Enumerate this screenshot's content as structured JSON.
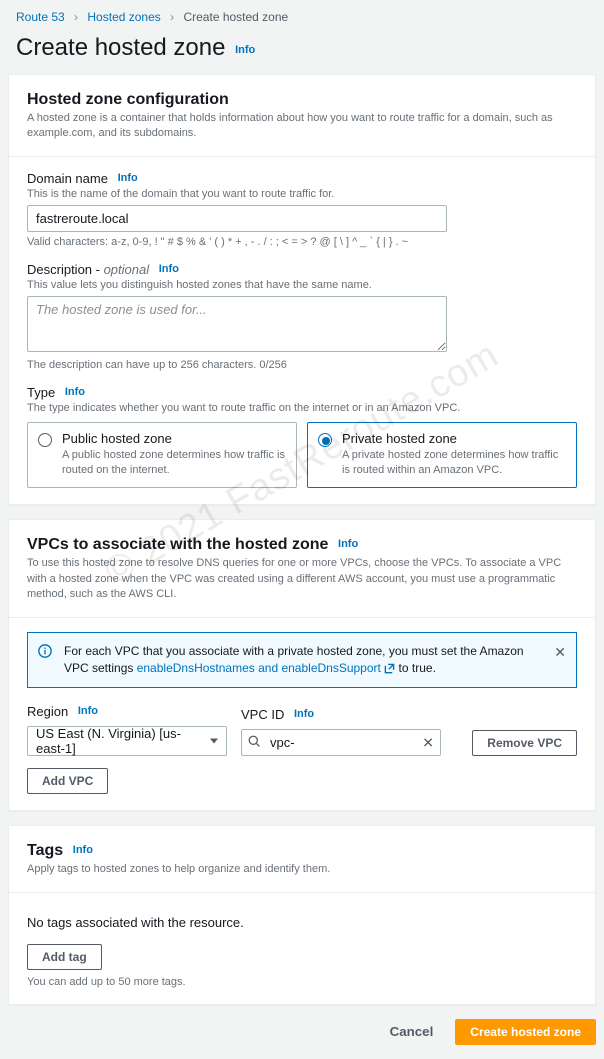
{
  "breadcrumb": {
    "root": "Route 53",
    "mid": "Hosted zones",
    "current": "Create hosted zone"
  },
  "page": {
    "title": "Create hosted zone",
    "info": "Info"
  },
  "config": {
    "heading": "Hosted zone configuration",
    "desc": "A hosted zone is a container that holds information about how you want to route traffic for a domain, such as example.com, and its subdomains.",
    "domain": {
      "label": "Domain name",
      "desc": "This is the name of the domain that you want to route traffic for.",
      "value": "fastreroute.local",
      "hint": "Valid characters: a-z, 0-9, ! \" # $ % & ' ( ) * + , - . / : ; < = > ? @ [ \\ ] ^ _ ` { | } . ~"
    },
    "description": {
      "label": "Description - ",
      "optional": "optional",
      "desc": "This value lets you distinguish hosted zones that have the same name.",
      "placeholder": "The hosted zone is used for...",
      "value": "",
      "hint": "The description can have up to 256 characters. 0/256"
    },
    "type": {
      "label": "Type",
      "desc": "The type indicates whether you want to route traffic on the internet or in an Amazon VPC.",
      "public": {
        "title": "Public hosted zone",
        "desc": "A public hosted zone determines how traffic is routed on the internet."
      },
      "private": {
        "title": "Private hosted zone",
        "desc": "A private hosted zone determines how traffic is routed within an Amazon VPC."
      }
    }
  },
  "vpcs": {
    "heading": "VPCs to associate with the hosted zone",
    "desc": "To use this hosted zone to resolve DNS queries for one or more VPCs, choose the VPCs. To associate a VPC with a hosted zone when the VPC was created using a different AWS account, you must use a programmatic method, such as the AWS CLI.",
    "alert": {
      "text1": "For each VPC that you associate with a private hosted zone, you must set the Amazon VPC settings ",
      "link": "enableDnsHostnames and enableDnsSupport",
      "text2": " to true."
    },
    "region": {
      "label": "Region",
      "value": "US East (N. Virginia) [us-east-1]"
    },
    "vpcid": {
      "label": "VPC ID",
      "value": "vpc-"
    },
    "remove": "Remove VPC",
    "add": "Add VPC"
  },
  "tags": {
    "heading": "Tags",
    "desc": "Apply tags to hosted zones to help organize and identify them.",
    "empty": "No tags associated with the resource.",
    "add": "Add tag",
    "hint": "You can add up to 50 more tags."
  },
  "footer": {
    "cancel": "Cancel",
    "create": "Create hosted zone"
  },
  "info": "Info"
}
